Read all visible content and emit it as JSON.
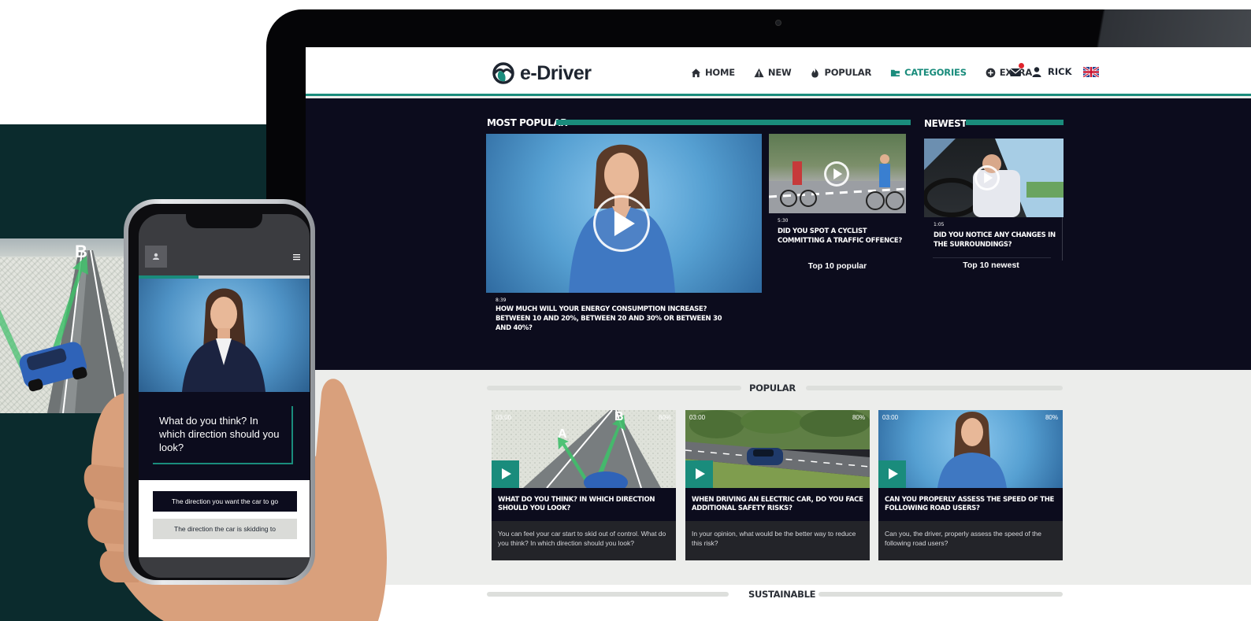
{
  "brand": {
    "name": "e-Driver",
    "accent": "#1a8c7c",
    "dark": "#0c0c1d"
  },
  "nav": {
    "items": [
      {
        "label": "HOME",
        "icon": "home-icon",
        "active": false
      },
      {
        "label": "NEW",
        "icon": "warning-icon",
        "active": false
      },
      {
        "label": "POPULAR",
        "icon": "flame-icon",
        "active": false
      },
      {
        "label": "CATEGORIES",
        "icon": "folder-icon",
        "active": true
      },
      {
        "label": "EXTRA",
        "icon": "plus-circle-icon",
        "active": false
      }
    ],
    "user": "RICK",
    "mail_icon": "mail-icon",
    "language_icon": "uk-flag-icon"
  },
  "hero": {
    "most_popular_title": "MOST POPULAR",
    "newest_title": "NEWEST",
    "featured": {
      "time": "8:39",
      "title": "HOW MUCH WILL YOUR ENERGY CONSUMPTION INCREASE? BETWEEN 10 AND 20%, BETWEEN 20 AND 30% OR BETWEEN 30 AND 40%?"
    },
    "second": {
      "time": "5:30",
      "title": "DID YOU SPOT A CYCLIST COMMITTING A TRAFFIC OFFENCE?"
    },
    "newest": {
      "time": "1:05",
      "title": "DID YOU NOTICE ANY CHANGES IN THE SURROUNDINGS?"
    },
    "top10_popular": "Top 10 popular",
    "top10_newest": "Top 10 newest"
  },
  "popular": {
    "title": "POPULAR",
    "cards": [
      {
        "duration": "03:00",
        "percent": "80%",
        "title": "WHAT DO YOU THINK? IN WHICH DIRECTION SHOULD YOU LOOK?",
        "desc": "You can feel your car start to skid out of control. What do you think? In which direction should you look?",
        "label_a": "A",
        "label_b": "B"
      },
      {
        "duration": "03:00",
        "percent": "80%",
        "title": "WHEN DRIVING AN ELECTRIC CAR, DO YOU FACE ADDITIONAL SAFETY RISKS?",
        "desc": "In your opinion, what would be the better way to reduce this risk?"
      },
      {
        "duration": "03:00",
        "percent": "80%",
        "title": "CAN YOU PROPERLY ASSESS THE SPEED OF THE FOLLOWING ROAD USERS?",
        "desc": "Can you, the driver, properly assess the speed of the following road users?"
      }
    ]
  },
  "sustainable": {
    "title": "SUSTAINABLE"
  },
  "scene": {
    "label_b": "B"
  },
  "phone": {
    "progress": 0.35,
    "question": "What do you think? In which direction should you look?",
    "answers": [
      "The direction you want the car to go",
      "The direction the car is skidding to"
    ]
  }
}
